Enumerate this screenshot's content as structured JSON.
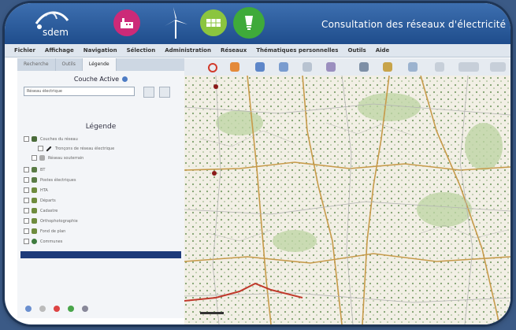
{
  "header": {
    "logo_text": "sdem",
    "title": "Consultation des réseaux d'électricité"
  },
  "colors": {
    "header_blue": "#2b5b9c",
    "magenta": "#cc2a78",
    "lime": "#8bc53f",
    "green": "#3faa3a",
    "selection": "#1d3b7a"
  },
  "icons": [
    "factory-icon",
    "wind-turbine-icon",
    "solar-panel-icon",
    "bulb-icon"
  ],
  "menu": [
    "Fichier",
    "Affichage",
    "Navigation",
    "Sélection",
    "Administration",
    "Réseaux",
    "Thématiques personnelles",
    "Outils",
    "Aide"
  ],
  "left_panel": {
    "tabs": [
      "Recherche",
      "Outils",
      "Légende"
    ],
    "couche_title": "Couche Active",
    "select_value": "Réseau électrique",
    "legende_title": "Légende",
    "layers": [
      "Couches du réseau",
      "Tronçons de réseau électrique",
      "Réseau souterrain",
      "BT",
      "Postes électriques",
      "HTA",
      "Départs",
      "Cadastre",
      "Orthophotographie",
      "Fond de plan",
      "Communes"
    ]
  }
}
